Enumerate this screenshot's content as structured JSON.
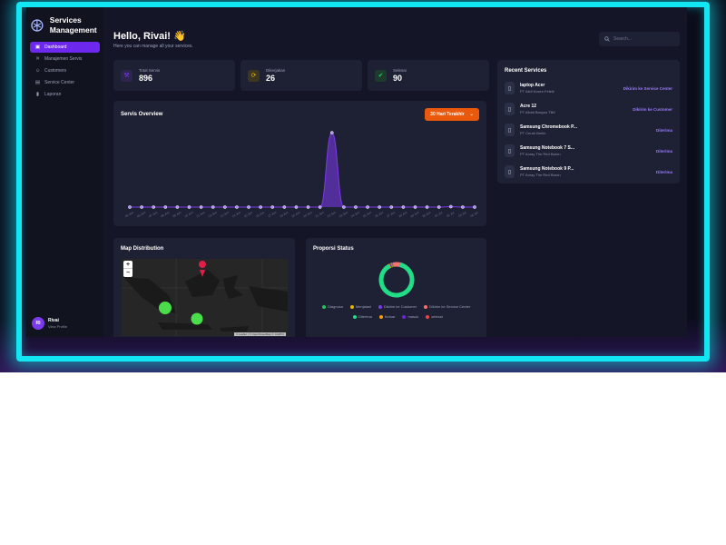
{
  "brand": {
    "title": "Services Management"
  },
  "sidebar": {
    "items": [
      {
        "label": "Dashboard",
        "icon": "dashboard-icon",
        "glyph": "▣",
        "active": true
      },
      {
        "label": "Manajemen Servis",
        "icon": "wrench-icon",
        "glyph": "✕",
        "active": false
      },
      {
        "label": "Customers",
        "icon": "users-icon",
        "glyph": "☺",
        "active": false
      },
      {
        "label": "Service Center",
        "icon": "building-icon",
        "glyph": "▤",
        "active": false
      },
      {
        "label": "Laporan",
        "icon": "report-icon",
        "glyph": "▮",
        "active": false
      }
    ]
  },
  "profile": {
    "initials": "RI",
    "name": "Rivai",
    "sub": "View Profile"
  },
  "header": {
    "greeting": "Hello, Rivai! 👋",
    "subtitle": "Here you can manage all your services.",
    "search_placeholder": "Search..."
  },
  "stats": [
    {
      "label": "Total Servis",
      "value": "896",
      "icon": "tools-icon",
      "glyph": "⚒",
      "color": "#7c3aed",
      "bg": "#2e2450"
    },
    {
      "label": "Dikerjakan",
      "value": "26",
      "icon": "sync-icon",
      "glyph": "⟳",
      "color": "#eab308",
      "bg": "#3d3620"
    },
    {
      "label": "Selesai",
      "value": "90",
      "icon": "check-icon",
      "glyph": "✔",
      "color": "#22c55e",
      "bg": "#1d3b2d"
    }
  ],
  "overview": {
    "title": "Servis Overview",
    "range_label": "30 Hari Terakhir",
    "chart_data": {
      "type": "area",
      "x": [
        "05 Jun",
        "06 Jun",
        "07 Jun",
        "08 Jun",
        "09 Jun",
        "10 Jun",
        "11 Jun",
        "12 Jun",
        "13 Jun",
        "14 Jun",
        "15 Jun",
        "16 Jun",
        "17 Jun",
        "18 Jun",
        "19 Jun",
        "20 Jun",
        "21 Jun",
        "22 Jun",
        "23 Jun",
        "24 Jun",
        "25 Jun",
        "26 Jun",
        "27 Jun",
        "28 Jun",
        "29 Jun",
        "30 Jun",
        "01 Jul",
        "02 Jul",
        "03 Jul",
        "04 Jul"
      ],
      "values": [
        0,
        0,
        0,
        0,
        0,
        0,
        0,
        0,
        0,
        0,
        0,
        0,
        0,
        0,
        0,
        0,
        0,
        160,
        0,
        0,
        0,
        0,
        0,
        0,
        0,
        0,
        0,
        1,
        0,
        0
      ],
      "ylim": [
        0,
        170
      ],
      "color": "#7c3aed"
    }
  },
  "recent": {
    "title": "Recent Services",
    "items": [
      {
        "title": "laptop Acer",
        "sub": "PT Alidi Kosen Felktii",
        "status": "Dikirim ke Service Center"
      },
      {
        "title": "Acre 12",
        "sub": "PT Albidi Banyus TBK",
        "status": "Dikirim ke Customer"
      },
      {
        "title": "Samsung Chromebook P...",
        "sub": "PT Cerah Berlin",
        "status": "Diterima"
      },
      {
        "title": "Samsung Notebook 7 S...",
        "sub": "PT Anray The Red Baron",
        "status": "Diterima"
      },
      {
        "title": "Samsung Notebook 9 P...",
        "sub": "PT Anray The Red Baron",
        "status": "Diterima"
      }
    ]
  },
  "map_card": {
    "title": "Map Distribution",
    "attribution": "© Leaflet | © OpenStreetMap © CARTO",
    "zoom_in": "+",
    "zoom_out": "−"
  },
  "status_card": {
    "title": "Proporsi Status",
    "chart_data": {
      "type": "pie",
      "labels": [
        "Diagnosa",
        "Menjalani",
        "Dikirim ke Customer",
        "Dikirim ke Service Center",
        "Diterima",
        "Keluar",
        "masuk",
        "selesai"
      ],
      "values": [
        1,
        0.5,
        0.5,
        7,
        90,
        1,
        0.5,
        0.5
      ],
      "colors": [
        "#22c55e",
        "#eab308",
        "#7c3aed",
        "#f87171",
        "#22dd88",
        "#f59e0b",
        "#6d28d9",
        "#ef4444"
      ]
    },
    "legend_row1": [
      {
        "label": "Diagnosa",
        "color": "#22c55e"
      },
      {
        "label": "Menjalani",
        "color": "#eab308"
      },
      {
        "label": "Dikirim ke Customer",
        "color": "#7c3aed"
      },
      {
        "label": "Dikirim ke Service Center",
        "color": "#f87171"
      }
    ],
    "legend_row2": [
      {
        "label": "Diterima",
        "color": "#22dd88"
      },
      {
        "label": "Keluar",
        "color": "#f59e0b"
      },
      {
        "label": "masuk",
        "color": "#6d28d9"
      },
      {
        "label": "selesai",
        "color": "#ef4444"
      }
    ]
  }
}
